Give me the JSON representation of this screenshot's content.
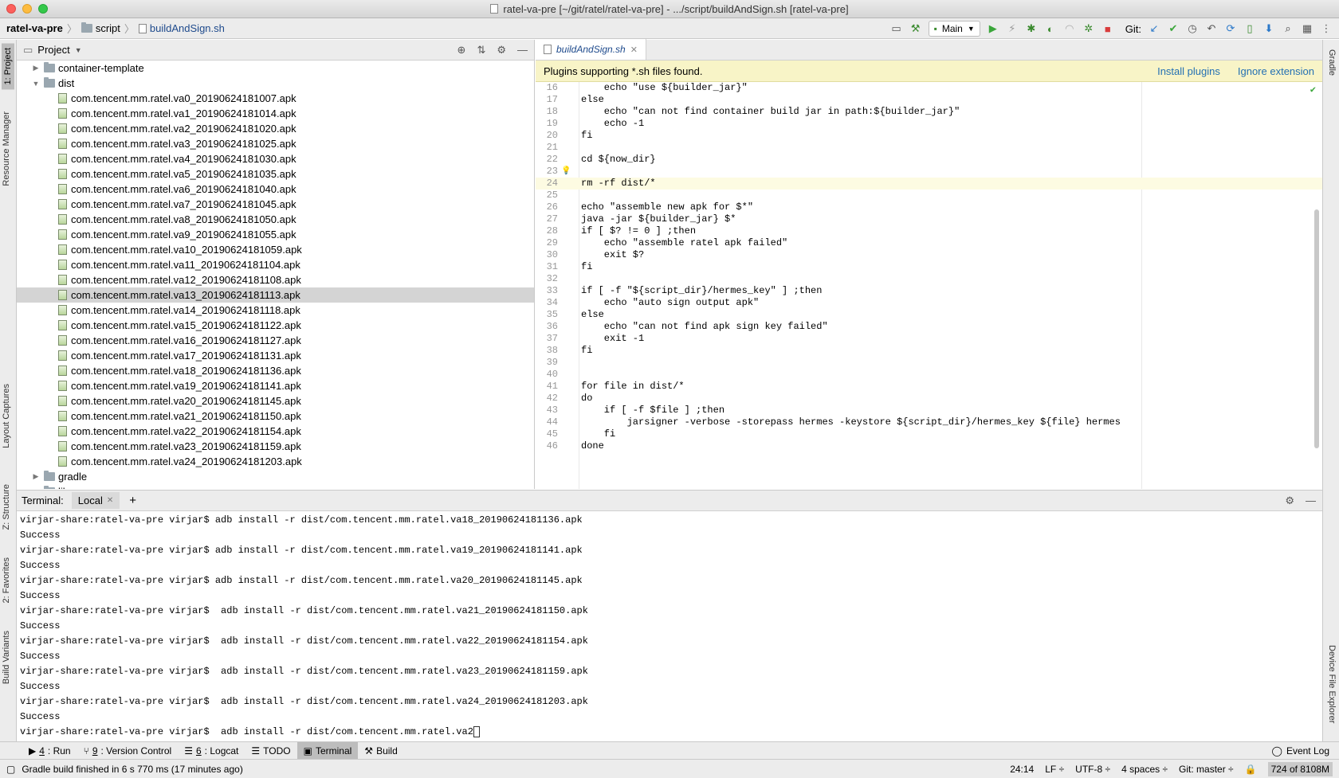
{
  "window": {
    "title": "ratel-va-pre [~/git/ratel/ratel-va-pre] - .../script/buildAndSign.sh [ratel-va-pre]"
  },
  "breadcrumb": {
    "project": "ratel-va-pre",
    "folder": "script",
    "file": "buildAndSign.sh"
  },
  "toolbar": {
    "run_config": "Main",
    "git_label": "Git:"
  },
  "left_tabs": [
    "1: Project",
    "Resource Manager",
    "Layout Captures",
    "Z: Structure",
    "2: Favorites",
    "Build Variants"
  ],
  "right_tabs": [
    "Gradle",
    "Device File Explorer"
  ],
  "project_panel": {
    "title": "Project",
    "tree": [
      {
        "level": 1,
        "arrow": "▶",
        "type": "folder",
        "label": "container-template"
      },
      {
        "level": 1,
        "arrow": "▼",
        "type": "folder",
        "label": "dist"
      },
      {
        "level": 2,
        "type": "apk",
        "label": "com.tencent.mm.ratel.va0_20190624181007.apk"
      },
      {
        "level": 2,
        "type": "apk",
        "label": "com.tencent.mm.ratel.va1_20190624181014.apk"
      },
      {
        "level": 2,
        "type": "apk",
        "label": "com.tencent.mm.ratel.va2_20190624181020.apk"
      },
      {
        "level": 2,
        "type": "apk",
        "label": "com.tencent.mm.ratel.va3_20190624181025.apk"
      },
      {
        "level": 2,
        "type": "apk",
        "label": "com.tencent.mm.ratel.va4_20190624181030.apk"
      },
      {
        "level": 2,
        "type": "apk",
        "label": "com.tencent.mm.ratel.va5_20190624181035.apk"
      },
      {
        "level": 2,
        "type": "apk",
        "label": "com.tencent.mm.ratel.va6_20190624181040.apk"
      },
      {
        "level": 2,
        "type": "apk",
        "label": "com.tencent.mm.ratel.va7_20190624181045.apk"
      },
      {
        "level": 2,
        "type": "apk",
        "label": "com.tencent.mm.ratel.va8_20190624181050.apk"
      },
      {
        "level": 2,
        "type": "apk",
        "label": "com.tencent.mm.ratel.va9_20190624181055.apk"
      },
      {
        "level": 2,
        "type": "apk",
        "label": "com.tencent.mm.ratel.va10_20190624181059.apk"
      },
      {
        "level": 2,
        "type": "apk",
        "label": "com.tencent.mm.ratel.va11_20190624181104.apk"
      },
      {
        "level": 2,
        "type": "apk",
        "label": "com.tencent.mm.ratel.va12_20190624181108.apk"
      },
      {
        "level": 2,
        "type": "apk",
        "label": "com.tencent.mm.ratel.va13_20190624181113.apk",
        "selected": true
      },
      {
        "level": 2,
        "type": "apk",
        "label": "com.tencent.mm.ratel.va14_20190624181118.apk"
      },
      {
        "level": 2,
        "type": "apk",
        "label": "com.tencent.mm.ratel.va15_20190624181122.apk"
      },
      {
        "level": 2,
        "type": "apk",
        "label": "com.tencent.mm.ratel.va16_20190624181127.apk"
      },
      {
        "level": 2,
        "type": "apk",
        "label": "com.tencent.mm.ratel.va17_20190624181131.apk"
      },
      {
        "level": 2,
        "type": "apk",
        "label": "com.tencent.mm.ratel.va18_20190624181136.apk"
      },
      {
        "level": 2,
        "type": "apk",
        "label": "com.tencent.mm.ratel.va19_20190624181141.apk"
      },
      {
        "level": 2,
        "type": "apk",
        "label": "com.tencent.mm.ratel.va20_20190624181145.apk"
      },
      {
        "level": 2,
        "type": "apk",
        "label": "com.tencent.mm.ratel.va21_20190624181150.apk"
      },
      {
        "level": 2,
        "type": "apk",
        "label": "com.tencent.mm.ratel.va22_20190624181154.apk"
      },
      {
        "level": 2,
        "type": "apk",
        "label": "com.tencent.mm.ratel.va23_20190624181159.apk"
      },
      {
        "level": 2,
        "type": "apk",
        "label": "com.tencent.mm.ratel.va24_20190624181203.apk"
      },
      {
        "level": 1,
        "arrow": "▶",
        "type": "folder",
        "label": "gradle"
      },
      {
        "level": 1,
        "arrow": "▶",
        "type": "folder",
        "label": "lib"
      }
    ]
  },
  "editor": {
    "tab": "buildAndSign.sh",
    "banner": {
      "message": "Plugins supporting *.sh files found.",
      "install": "Install plugins",
      "ignore": "Ignore extension"
    },
    "current_line": 24,
    "lines": [
      {
        "n": "16",
        "t": "    echo \"use ${builder_jar}\""
      },
      {
        "n": "17",
        "t": "else"
      },
      {
        "n": "18",
        "t": "    echo \"can not find container build jar in path:${builder_jar}\""
      },
      {
        "n": "19",
        "t": "    echo -1"
      },
      {
        "n": "20",
        "t": "fi"
      },
      {
        "n": "21",
        "t": ""
      },
      {
        "n": "22",
        "t": "cd ${now_dir}"
      },
      {
        "n": "23",
        "t": ""
      },
      {
        "n": "24",
        "t": "rm -rf dist/*"
      },
      {
        "n": "25",
        "t": ""
      },
      {
        "n": "26",
        "t": "echo \"assemble new apk for $*\""
      },
      {
        "n": "27",
        "t": "java -jar ${builder_jar} $*"
      },
      {
        "n": "28",
        "t": "if [ $? != 0 ] ;then"
      },
      {
        "n": "29",
        "t": "    echo \"assemble ratel apk failed\""
      },
      {
        "n": "30",
        "t": "    exit $?"
      },
      {
        "n": "31",
        "t": "fi"
      },
      {
        "n": "32",
        "t": ""
      },
      {
        "n": "33",
        "t": "if [ -f \"${script_dir}/hermes_key\" ] ;then"
      },
      {
        "n": "34",
        "t": "    echo \"auto sign output apk\""
      },
      {
        "n": "35",
        "t": "else"
      },
      {
        "n": "36",
        "t": "    echo \"can not find apk sign key failed\""
      },
      {
        "n": "37",
        "t": "    exit -1"
      },
      {
        "n": "38",
        "t": "fi"
      },
      {
        "n": "39",
        "t": ""
      },
      {
        "n": "40",
        "t": ""
      },
      {
        "n": "41",
        "t": "for file in dist/*"
      },
      {
        "n": "42",
        "t": "do"
      },
      {
        "n": "43",
        "t": "    if [ -f $file ] ;then"
      },
      {
        "n": "44",
        "t": "        jarsigner -verbose -storepass hermes -keystore ${script_dir}/hermes_key ${file} hermes"
      },
      {
        "n": "45",
        "t": "    fi"
      },
      {
        "n": "46",
        "t": "done"
      }
    ]
  },
  "terminal": {
    "label": "Terminal:",
    "tab": "Local",
    "lines": [
      "virjar-share:ratel-va-pre virjar$ adb install -r dist/com.tencent.mm.ratel.va18_20190624181136.apk",
      "Success",
      "virjar-share:ratel-va-pre virjar$ adb install -r dist/com.tencent.mm.ratel.va19_20190624181141.apk",
      "Success",
      "virjar-share:ratel-va-pre virjar$ adb install -r dist/com.tencent.mm.ratel.va20_20190624181145.apk",
      "Success",
      "virjar-share:ratel-va-pre virjar$  adb install -r dist/com.tencent.mm.ratel.va21_20190624181150.apk",
      "Success",
      "virjar-share:ratel-va-pre virjar$  adb install -r dist/com.tencent.mm.ratel.va22_20190624181154.apk",
      "Success",
      "virjar-share:ratel-va-pre virjar$  adb install -r dist/com.tencent.mm.ratel.va23_20190624181159.apk",
      "Success",
      "virjar-share:ratel-va-pre virjar$  adb install -r dist/com.tencent.mm.ratel.va24_20190624181203.apk",
      "Success"
    ],
    "prompt": "virjar-share:ratel-va-pre virjar$  adb install -r dist/com.tencent.mm.ratel.va2"
  },
  "bottom_tabs": [
    {
      "key": "4",
      "label": ": Run",
      "icon": "▶"
    },
    {
      "key": "9",
      "label": ": Version Control",
      "icon": "⑂"
    },
    {
      "key": "6",
      "label": ": Logcat",
      "icon": "☰"
    },
    {
      "key": "",
      "label": "TODO",
      "icon": "☰"
    },
    {
      "key": "",
      "label": "Terminal",
      "icon": "▣",
      "active": true
    },
    {
      "key": "",
      "label": "Build",
      "icon": "⚒"
    }
  ],
  "event_log": "Event Log",
  "status": {
    "message": "Gradle build finished in 6 s 770 ms (17 minutes ago)",
    "position": "24:14",
    "line_sep": "LF ÷",
    "encoding": "UTF-8 ÷",
    "indent": "4 spaces ÷",
    "git": "Git: master ÷",
    "memory": "724 of 8108M"
  }
}
